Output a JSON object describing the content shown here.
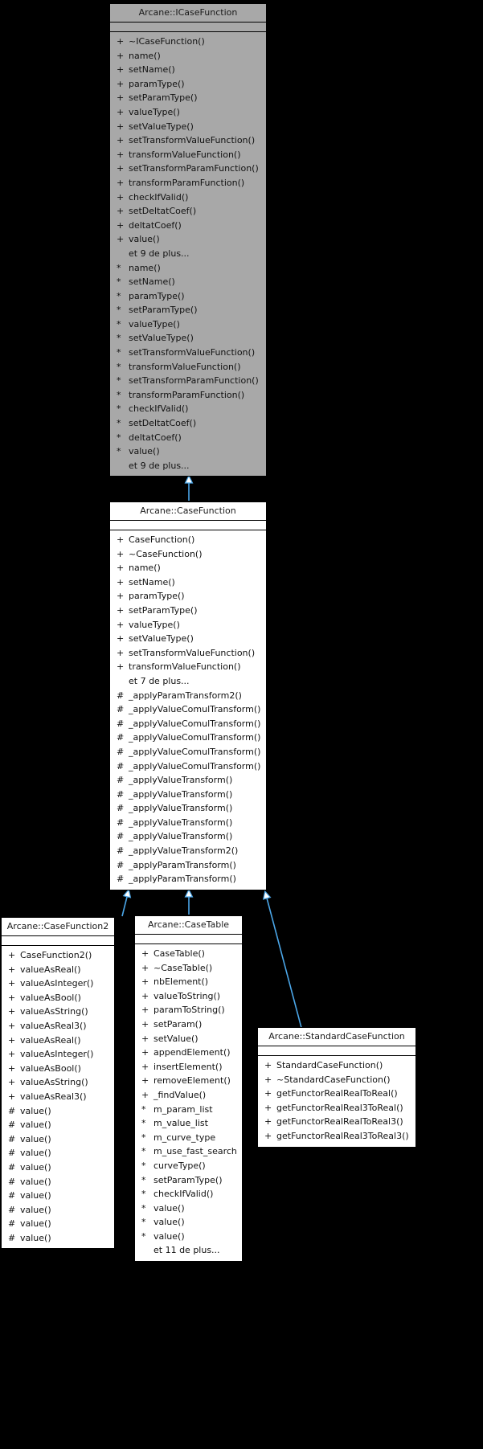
{
  "diagram": {
    "type": "uml-inheritance-graph",
    "background": "#000000",
    "edge_color": "#4ba6e8",
    "abstract_fill": "#a8a8a8",
    "concrete_fill": "#ffffff",
    "border_color": "#000000",
    "more_label_9": "et 9 de plus...",
    "more_label_7": "et 7 de plus...",
    "more_label_11": "et 11 de plus..."
  },
  "classes": [
    {
      "id": "icasefunction",
      "title": "Arcane::ICaseFunction",
      "abstract": true,
      "members": [
        {
          "vis": "+",
          "name": "~ICaseFunction()"
        },
        {
          "vis": "+",
          "name": "name()"
        },
        {
          "vis": "+",
          "name": "setName()"
        },
        {
          "vis": "+",
          "name": "paramType()"
        },
        {
          "vis": "+",
          "name": "setParamType()"
        },
        {
          "vis": "+",
          "name": "valueType()"
        },
        {
          "vis": "+",
          "name": "setValueType()"
        },
        {
          "vis": "+",
          "name": "setTransformValueFunction()"
        },
        {
          "vis": "+",
          "name": "transformValueFunction()"
        },
        {
          "vis": "+",
          "name": "setTransformParamFunction()"
        },
        {
          "vis": "+",
          "name": "transformParamFunction()"
        },
        {
          "vis": "+",
          "name": "checkIfValid()"
        },
        {
          "vis": "+",
          "name": "setDeltatCoef()"
        },
        {
          "vis": "+",
          "name": "deltatCoef()"
        },
        {
          "vis": "+",
          "name": "value()"
        },
        {
          "vis": "",
          "name": "et 9 de plus...",
          "more": true
        },
        {
          "vis": "*",
          "name": "name()"
        },
        {
          "vis": "*",
          "name": "setName()"
        },
        {
          "vis": "*",
          "name": "paramType()"
        },
        {
          "vis": "*",
          "name": "setParamType()"
        },
        {
          "vis": "*",
          "name": "valueType()"
        },
        {
          "vis": "*",
          "name": "setValueType()"
        },
        {
          "vis": "*",
          "name": "setTransformValueFunction()"
        },
        {
          "vis": "*",
          "name": "transformValueFunction()"
        },
        {
          "vis": "*",
          "name": "setTransformParamFunction()"
        },
        {
          "vis": "*",
          "name": "transformParamFunction()"
        },
        {
          "vis": "*",
          "name": "checkIfValid()"
        },
        {
          "vis": "*",
          "name": "setDeltatCoef()"
        },
        {
          "vis": "*",
          "name": "deltatCoef()"
        },
        {
          "vis": "*",
          "name": "value()"
        },
        {
          "vis": "",
          "name": "et 9 de plus...",
          "more": true
        }
      ]
    },
    {
      "id": "casefunction",
      "title": "Arcane::CaseFunction",
      "abstract": false,
      "members": [
        {
          "vis": "+",
          "name": "CaseFunction()"
        },
        {
          "vis": "+",
          "name": "~CaseFunction()"
        },
        {
          "vis": "+",
          "name": "name()"
        },
        {
          "vis": "+",
          "name": "setName()"
        },
        {
          "vis": "+",
          "name": "paramType()"
        },
        {
          "vis": "+",
          "name": "setParamType()"
        },
        {
          "vis": "+",
          "name": "valueType()"
        },
        {
          "vis": "+",
          "name": "setValueType()"
        },
        {
          "vis": "+",
          "name": "setTransformValueFunction()"
        },
        {
          "vis": "+",
          "name": "transformValueFunction()"
        },
        {
          "vis": "",
          "name": "et 7 de plus...",
          "more": true
        },
        {
          "vis": "#",
          "name": "_applyParamTransform2()"
        },
        {
          "vis": "#",
          "name": "_applyValueComulTransform()"
        },
        {
          "vis": "#",
          "name": "_applyValueComulTransform()"
        },
        {
          "vis": "#",
          "name": "_applyValueComulTransform()"
        },
        {
          "vis": "#",
          "name": "_applyValueComulTransform()"
        },
        {
          "vis": "#",
          "name": "_applyValueComulTransform()"
        },
        {
          "vis": "#",
          "name": "_applyValueTransform()"
        },
        {
          "vis": "#",
          "name": "_applyValueTransform()"
        },
        {
          "vis": "#",
          "name": "_applyValueTransform()"
        },
        {
          "vis": "#",
          "name": "_applyValueTransform()"
        },
        {
          "vis": "#",
          "name": "_applyValueTransform()"
        },
        {
          "vis": "#",
          "name": "_applyValueTransform2()"
        },
        {
          "vis": "#",
          "name": "_applyParamTransform()"
        },
        {
          "vis": "#",
          "name": "_applyParamTransform()"
        }
      ]
    },
    {
      "id": "casefunction2",
      "title": "Arcane::CaseFunction2",
      "abstract": false,
      "members": [
        {
          "vis": "+",
          "name": "CaseFunction2()"
        },
        {
          "vis": "+",
          "name": "valueAsReal()"
        },
        {
          "vis": "+",
          "name": "valueAsInteger()"
        },
        {
          "vis": "+",
          "name": "valueAsBool()"
        },
        {
          "vis": "+",
          "name": "valueAsString()"
        },
        {
          "vis": "+",
          "name": "valueAsReal3()"
        },
        {
          "vis": "+",
          "name": "valueAsReal()"
        },
        {
          "vis": "+",
          "name": "valueAsInteger()"
        },
        {
          "vis": "+",
          "name": "valueAsBool()"
        },
        {
          "vis": "+",
          "name": "valueAsString()"
        },
        {
          "vis": "+",
          "name": "valueAsReal3()"
        },
        {
          "vis": "#",
          "name": "value()"
        },
        {
          "vis": "#",
          "name": "value()"
        },
        {
          "vis": "#",
          "name": "value()"
        },
        {
          "vis": "#",
          "name": "value()"
        },
        {
          "vis": "#",
          "name": "value()"
        },
        {
          "vis": "#",
          "name": "value()"
        },
        {
          "vis": "#",
          "name": "value()"
        },
        {
          "vis": "#",
          "name": "value()"
        },
        {
          "vis": "#",
          "name": "value()"
        },
        {
          "vis": "#",
          "name": "value()"
        }
      ]
    },
    {
      "id": "casetable",
      "title": "Arcane::CaseTable",
      "abstract": false,
      "members": [
        {
          "vis": "+",
          "name": "CaseTable()"
        },
        {
          "vis": "+",
          "name": "~CaseTable()"
        },
        {
          "vis": "+",
          "name": "nbElement()"
        },
        {
          "vis": "+",
          "name": "valueToString()"
        },
        {
          "vis": "+",
          "name": "paramToString()"
        },
        {
          "vis": "+",
          "name": "setParam()"
        },
        {
          "vis": "+",
          "name": "setValue()"
        },
        {
          "vis": "+",
          "name": "appendElement()"
        },
        {
          "vis": "+",
          "name": "insertElement()"
        },
        {
          "vis": "+",
          "name": "removeElement()"
        },
        {
          "vis": "+",
          "name": "_findValue()"
        },
        {
          "vis": "*",
          "name": "m_param_list"
        },
        {
          "vis": "*",
          "name": "m_value_list"
        },
        {
          "vis": "*",
          "name": "m_curve_type"
        },
        {
          "vis": "*",
          "name": "m_use_fast_search"
        },
        {
          "vis": "*",
          "name": "curveType()"
        },
        {
          "vis": "*",
          "name": "setParamType()"
        },
        {
          "vis": "*",
          "name": "checkIfValid()"
        },
        {
          "vis": "*",
          "name": "value()"
        },
        {
          "vis": "*",
          "name": "value()"
        },
        {
          "vis": "*",
          "name": "value()"
        },
        {
          "vis": "",
          "name": "et 11 de plus...",
          "more": true
        }
      ]
    },
    {
      "id": "standardcasefunction",
      "title": "Arcane::StandardCaseFunction",
      "abstract": false,
      "members": [
        {
          "vis": "+",
          "name": "StandardCaseFunction()"
        },
        {
          "vis": "+",
          "name": "~StandardCaseFunction()"
        },
        {
          "vis": "+",
          "name": "getFunctorRealRealToReal()"
        },
        {
          "vis": "+",
          "name": "getFunctorRealReal3ToReal()"
        },
        {
          "vis": "+",
          "name": "getFunctorRealRealToReal3()"
        },
        {
          "vis": "+",
          "name": "getFunctorRealReal3ToReal3()"
        }
      ]
    }
  ],
  "edges": [
    {
      "from": "casefunction",
      "to": "icasefunction",
      "kind": "inheritance"
    },
    {
      "from": "casefunction2",
      "to": "casefunction",
      "kind": "inheritance"
    },
    {
      "from": "casetable",
      "to": "casefunction",
      "kind": "inheritance"
    },
    {
      "from": "standardcasefunction",
      "to": "casefunction",
      "kind": "inheritance"
    }
  ]
}
